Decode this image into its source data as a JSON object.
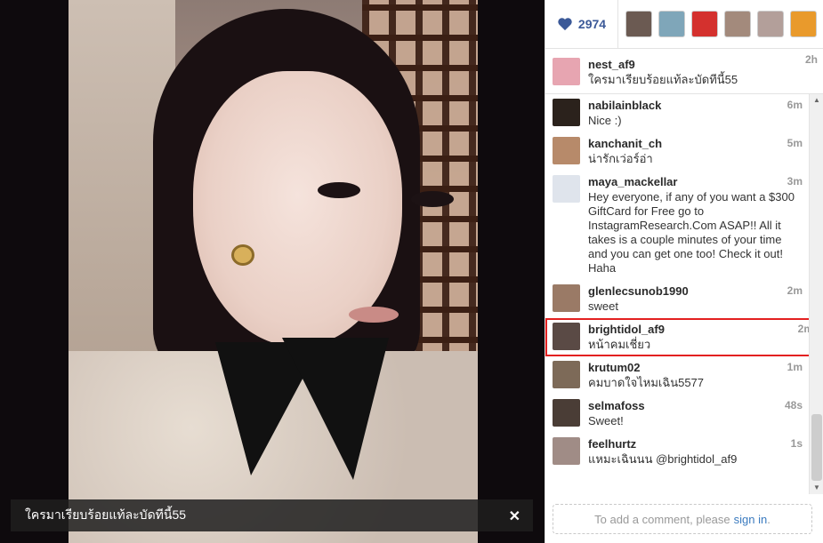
{
  "photo_caption": "ใครมาเรียบร้อยแท้ละบัดทีนี้55",
  "close_glyph": "✕",
  "likes": {
    "count": "2974",
    "heart_icon": "heart-icon",
    "liker_colors": [
      "#6b5a52",
      "#7fa6b9",
      "#d4312e",
      "#a38a7c",
      "#b39f9a",
      "#e99a2c"
    ]
  },
  "caption_comment": {
    "user": "nest_af9",
    "text": "ใครมาเรียบร้อยแท้ละบัดทีนี้55",
    "time": "2h",
    "avatar_color": "#e7a5b1"
  },
  "comments": [
    {
      "user": "nabilainblack",
      "text": "Nice :)",
      "time": "6m",
      "avatar_color": "#2b221c"
    },
    {
      "user": "kanchanit_ch",
      "text": "น่ารักเว่อร์อ่า",
      "time": "5m",
      "avatar_color": "#b78a6a"
    },
    {
      "user": "maya_mackellar",
      "text": "Hey everyone, if any of you want a $300 GiftCard for Free go to InstagramResearch.Com ASAP!! All it takes is a couple minutes of your time and you can get one too! Check it out! Haha",
      "time": "3m",
      "avatar_color": "#dfe4ec"
    },
    {
      "user": "glenlecsunob1990",
      "text": "sweet",
      "time": "2m",
      "avatar_color": "#9a7a66"
    },
    {
      "user": "brightidol_af9",
      "text": "หน้าคมเชี่ยว",
      "time": "2m",
      "avatar_color": "#5a4a45"
    },
    {
      "user": "krutum02",
      "text": "คมบาดใจไหมเฉิน5577",
      "time": "1m",
      "avatar_color": "#7d6a58"
    },
    {
      "user": "selmafoss",
      "text": "Sweet!",
      "time": "48s",
      "avatar_color": "#4a3d36"
    },
    {
      "user": "feelhurtz",
      "text": "แหมะเฉินนน @brightidol_af9",
      "time": "1s",
      "avatar_color": "#a08c86"
    }
  ],
  "add_comment": {
    "prompt": "To add a comment, please",
    "link": "sign in",
    "tail": "."
  },
  "scrollbar": {
    "up": "▲",
    "down": "▼"
  }
}
